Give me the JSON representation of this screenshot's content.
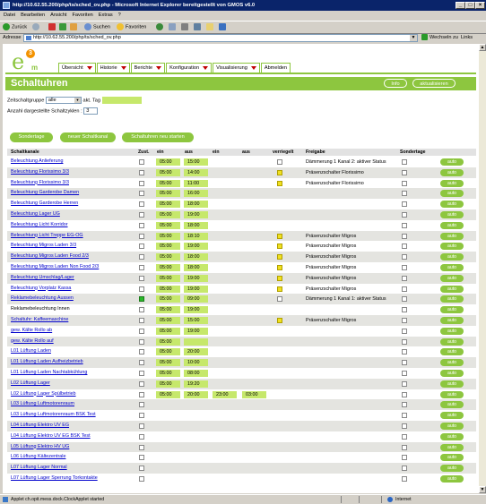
{
  "window": {
    "title": "http://10.62.55.200/php/ts/sched_ov.php - Microsoft Internet Explorer bereitgestellt von GMOS v6.0"
  },
  "menubar": [
    "Datei",
    "Bearbeiten",
    "Ansicht",
    "Favoriten",
    "Extras",
    "?"
  ],
  "toolbar": {
    "back": "Zurück",
    "search": "Suchen",
    "favorites": "Favoriten"
  },
  "address": {
    "label": "Adresse",
    "url": "http://10.62.55.200/php/ts/sched_ov.php",
    "go": "Wechseln zu",
    "links": "Links"
  },
  "logo": {
    "badge": "3",
    "letter": "e",
    "sub": "m"
  },
  "nav": [
    {
      "label": "Übersicht"
    },
    {
      "label": "Historie"
    },
    {
      "label": "Berichte"
    },
    {
      "label": "Konfiguration"
    },
    {
      "label": "Visualisierung"
    },
    {
      "label": "Abmelden"
    }
  ],
  "header": {
    "title": "Schaltuhren",
    "info": "Info",
    "refresh": "aktualisieren"
  },
  "filters": {
    "group_label": "Zeitschaltgruppe",
    "group_value": "alle",
    "day_label": "akt. Tag",
    "cycles_label": "Anzahl dargestellte Schaltzyklen :",
    "cycles_value": "3"
  },
  "actions": {
    "special_days": "Sondertage",
    "new_channel": "neuer Schaltkanal",
    "restart": "Schaltuhren neu starten"
  },
  "table": {
    "headers": {
      "channel": "Schaltkanale",
      "state": "Zust.",
      "on1": "ein",
      "off1": "aus",
      "on2": "ein",
      "off2": "aus",
      "locked": "verriegelt",
      "release": "Freigabe",
      "special": "Sondertage"
    },
    "auto_label": "auto",
    "rows": [
      {
        "name": "Beleuchtung Anlieferung",
        "on1": "05:00",
        "off1": "15:00",
        "on2": "",
        "off2": "",
        "state": "off",
        "locked": "off",
        "release": "Dämmerung 1 Kanal 2: aktiver Status",
        "linked": true
      },
      {
        "name": "Beleuchtung Florissimo 3/3",
        "on1": "05:00",
        "off1": "14:00",
        "on2": "",
        "off2": "",
        "state": "off",
        "locked": "yellow",
        "release": "Präsenzschalter Florissimo",
        "linked": true
      },
      {
        "name": "Beleuchtung Florissimo 3/3",
        "on1": "05:00",
        "off1": "11:00",
        "on2": "",
        "off2": "",
        "state": "off",
        "locked": "yellow",
        "release": "Präsenzschalter Florissimo",
        "linked": true
      },
      {
        "name": "Beleuchtung Garderobe Damen",
        "on1": "05:00",
        "off1": "16:00",
        "on2": "",
        "off2": "",
        "state": "off",
        "locked": "none",
        "release": "",
        "linked": true
      },
      {
        "name": "Beleuchtung Garderobe Herren",
        "on1": "05:00",
        "off1": "18:00",
        "on2": "",
        "off2": "",
        "state": "off",
        "locked": "none",
        "release": "",
        "linked": true
      },
      {
        "name": "Beleuchtung Lager UG",
        "on1": "05:00",
        "off1": "19:00",
        "on2": "",
        "off2": "",
        "state": "off",
        "locked": "none",
        "release": "",
        "linked": true
      },
      {
        "name": "Beleuchtung Licht Korridor",
        "on1": "05:00",
        "off1": "18:00",
        "on2": "",
        "off2": "",
        "state": "off",
        "locked": "none",
        "release": "",
        "linked": true
      },
      {
        "name": "Beleuchtung Licht Treppe EG-OG",
        "on1": "05:00",
        "off1": "18:10",
        "on2": "",
        "off2": "",
        "state": "off",
        "locked": "yellow",
        "release": "Präsenzschalter Migros",
        "linked": true
      },
      {
        "name": "Beleuchtung Migros Laden 3/3",
        "on1": "05:00",
        "off1": "19:00",
        "on2": "",
        "off2": "",
        "state": "off",
        "locked": "yellow",
        "release": "Präsenzschalter Migros",
        "linked": true
      },
      {
        "name": "Beleuchtung Migros Laden Food 2/3",
        "on1": "05:00",
        "off1": "18:00",
        "on2": "",
        "off2": "",
        "state": "off",
        "locked": "yellow",
        "release": "Präsenzschalter Migros",
        "linked": true
      },
      {
        "name": "Beleuchtung Migros Laden Non Food 2/3",
        "on1": "05:00",
        "off1": "18:00",
        "on2": "",
        "off2": "",
        "state": "off",
        "locked": "yellow",
        "release": "Präsenzschalter Migros",
        "linked": true
      },
      {
        "name": "Beleuchtung Umschlag/Lager",
        "on1": "05:00",
        "off1": "19:00",
        "on2": "",
        "off2": "",
        "state": "off",
        "locked": "yellow",
        "release": "Präsenzschalter Migros",
        "linked": true
      },
      {
        "name": "Beleuchtung Vorplatz Kassa",
        "on1": "05:00",
        "off1": "19:00",
        "on2": "",
        "off2": "",
        "state": "off",
        "locked": "yellow",
        "release": "Präsenzschalter Migros",
        "linked": true
      },
      {
        "name": "Reklamebeleuchtung Aussen",
        "on1": "05:00",
        "off1": "09:00",
        "on2": "",
        "off2": "",
        "state": "on",
        "locked": "off",
        "release": "Dämmerung 1 Kanal 1: aktiver Status",
        "linked": true
      },
      {
        "name": "Reklamebeleuchtung Innen",
        "on1": "05:00",
        "off1": "19:00",
        "on2": "",
        "off2": "",
        "state": "off",
        "locked": "none",
        "release": "",
        "linked": false
      },
      {
        "name": "Schaltuhr: Kaffeemaschine",
        "on1": "05:00",
        "off1": "15:00",
        "on2": "",
        "off2": "",
        "state": "off",
        "locked": "yellow",
        "release": "Präsenzschalter Migros",
        "linked": true
      },
      {
        "name": "gew. Kälte Rollo ab",
        "on1": "05:00",
        "off1": "19:00",
        "on2": "",
        "off2": "",
        "state": "off",
        "locked": "none",
        "release": "",
        "linked": true
      },
      {
        "name": "gew. Kälte Rollo auf",
        "on1": "05:00",
        "off1": "",
        "on2": "",
        "off2": "",
        "state": "off",
        "locked": "none",
        "release": "",
        "linked": true
      },
      {
        "name": "L01 Lüftung Laden",
        "on1": "05:00",
        "off1": "20:00",
        "on2": "",
        "off2": "",
        "state": "off",
        "locked": "none",
        "release": "",
        "linked": true
      },
      {
        "name": "L01 Lüftung Laden Aufheizbetrieb",
        "on1": "05:00",
        "off1": "10:00",
        "on2": "",
        "off2": "",
        "state": "off",
        "locked": "none",
        "release": "",
        "linked": true
      },
      {
        "name": "L01 Lüftung Laden Nachtabkühlung",
        "on1": "05:00",
        "off1": "08:00",
        "on2": "",
        "off2": "",
        "state": "off",
        "locked": "none",
        "release": "",
        "linked": true
      },
      {
        "name": "L02 Lüftung Lager",
        "on1": "05:00",
        "off1": "19:20",
        "on2": "",
        "off2": "",
        "state": "off",
        "locked": "none",
        "release": "",
        "linked": true
      },
      {
        "name": "L02 Lüftung Lager Spülbetrieb",
        "on1": "05:00",
        "off1": "20:00",
        "on2": "23:00",
        "off2": "03:00",
        "state": "off",
        "locked": "none",
        "release": "",
        "linked": true
      },
      {
        "name": "L03 Lüftung Luftmotorenraum",
        "on1": "",
        "off1": "",
        "on2": "",
        "off2": "",
        "state": "off",
        "locked": "none",
        "release": "",
        "linked": true
      },
      {
        "name": "L03 Lüftung Luftmotorenraum BSK Test",
        "on1": "",
        "off1": "",
        "on2": "",
        "off2": "",
        "state": "off",
        "locked": "none",
        "release": "",
        "linked": true
      },
      {
        "name": "L04 Lüftung Elektro UV EG",
        "on1": "",
        "off1": "",
        "on2": "",
        "off2": "",
        "state": "off",
        "locked": "none",
        "release": "",
        "linked": true
      },
      {
        "name": "L04 Lüftung Elektro UV EG BSK Test",
        "on1": "",
        "off1": "",
        "on2": "",
        "off2": "",
        "state": "off",
        "locked": "none",
        "release": "",
        "linked": true
      },
      {
        "name": "L05 Lüftung Elektro HV UG",
        "on1": "",
        "off1": "",
        "on2": "",
        "off2": "",
        "state": "off",
        "locked": "none",
        "release": "",
        "linked": true
      },
      {
        "name": "L06 Lüftung Kältezentrale",
        "on1": "",
        "off1": "",
        "on2": "",
        "off2": "",
        "state": "off",
        "locked": "none",
        "release": "",
        "linked": true
      },
      {
        "name": "L07 Lüftung Lager Normal",
        "on1": "",
        "off1": "",
        "on2": "",
        "off2": "",
        "state": "off",
        "locked": "none",
        "release": "",
        "linked": true
      },
      {
        "name": "L07 Lüftung Lager Sperrung Torkontakte",
        "on1": "",
        "off1": "",
        "on2": "",
        "off2": "",
        "state": "off",
        "locked": "none",
        "release": "",
        "linked": true
      }
    ]
  },
  "status": {
    "text": "Applet ch.opit.mess.dock.ClockApplet started",
    "zone": "Internet"
  },
  "colors": {
    "brand_green": "#8dc63f",
    "cell_green": "#c6e86b",
    "accent_orange": "#f39200",
    "caret_red": "#c00000"
  }
}
